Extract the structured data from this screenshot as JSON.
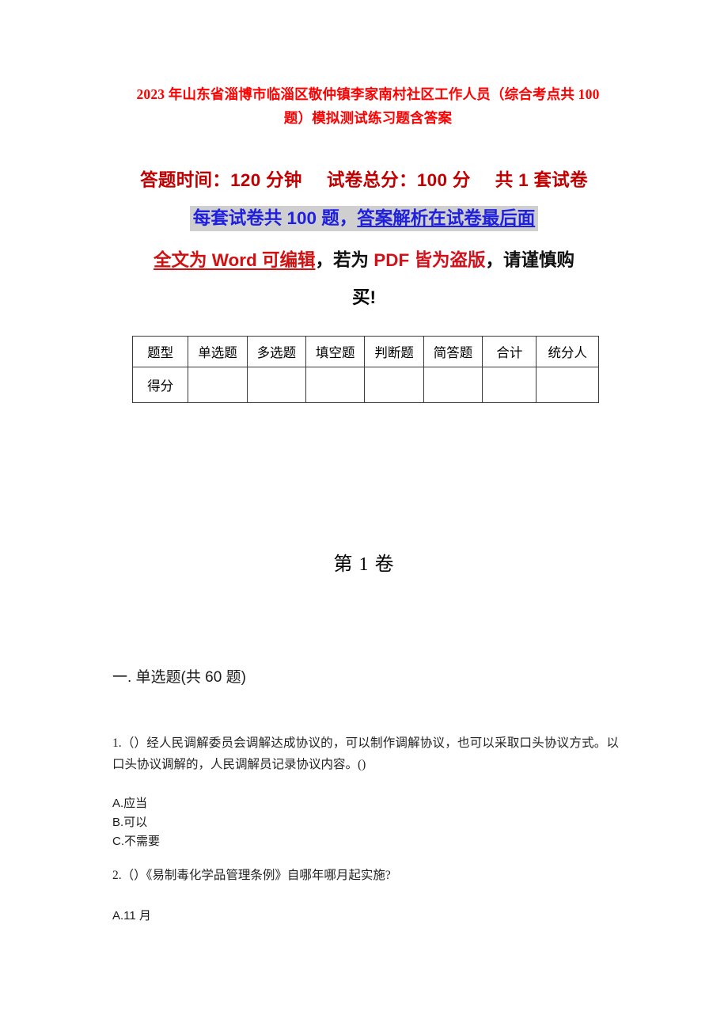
{
  "document": {
    "title_line1": "2023 年山东省淄博市临淄区敬仲镇李家南村社区工作人员（综合考点共 100",
    "title_line2": "题）模拟测试练习题含答案",
    "exam_info": {
      "duration_label": "答题时间：120 分钟",
      "total_score_label": "试卷总分：100 分",
      "set_count_label": "共 1 套试卷"
    },
    "notice_line": {
      "part1": "每套试卷共 100 题，",
      "part2_underlined": "答案解析在试卷最后面"
    },
    "copyright_notice": {
      "seg1_red_underline": "全文为 Word 可编辑",
      "seg2_black": "，若为 ",
      "seg3_red": "PDF 皆为盗版",
      "seg4_black": "，请谨慎购",
      "seg5_line2": "买!"
    },
    "volume_label": "第 1 卷",
    "section_heading": "一. 单选题(共 60 题)"
  },
  "score_table": {
    "headers": [
      "题型",
      "单选题",
      "多选题",
      "填空题",
      "判断题",
      "简答题",
      "合计",
      "统分人"
    ],
    "rows": [
      {
        "label": "得分",
        "values": [
          "",
          "",
          "",
          "",
          "",
          "",
          ""
        ]
      }
    ]
  },
  "questions": [
    {
      "number": "1.",
      "text": "1.（）经人民调解委员会调解达成协议的，可以制作调解协议，也可以采取口头协议方式。以口头协议调解的，人民调解员记录协议内容。()",
      "options": [
        "A.应当",
        "B.可以",
        "C.不需要"
      ]
    },
    {
      "number": "2.",
      "text": "2.（）《易制毒化学品管理条例》自哪年哪月起实施?",
      "options": [
        "A.11 月"
      ]
    }
  ],
  "colors": {
    "title_red": "#fe0000",
    "sub_dark_red": "#c00000",
    "notice_blue": "#1f1fe0",
    "highlight_gray": "#cfcfcf",
    "bright_red": "#d4101a",
    "body_black": "#222222"
  }
}
